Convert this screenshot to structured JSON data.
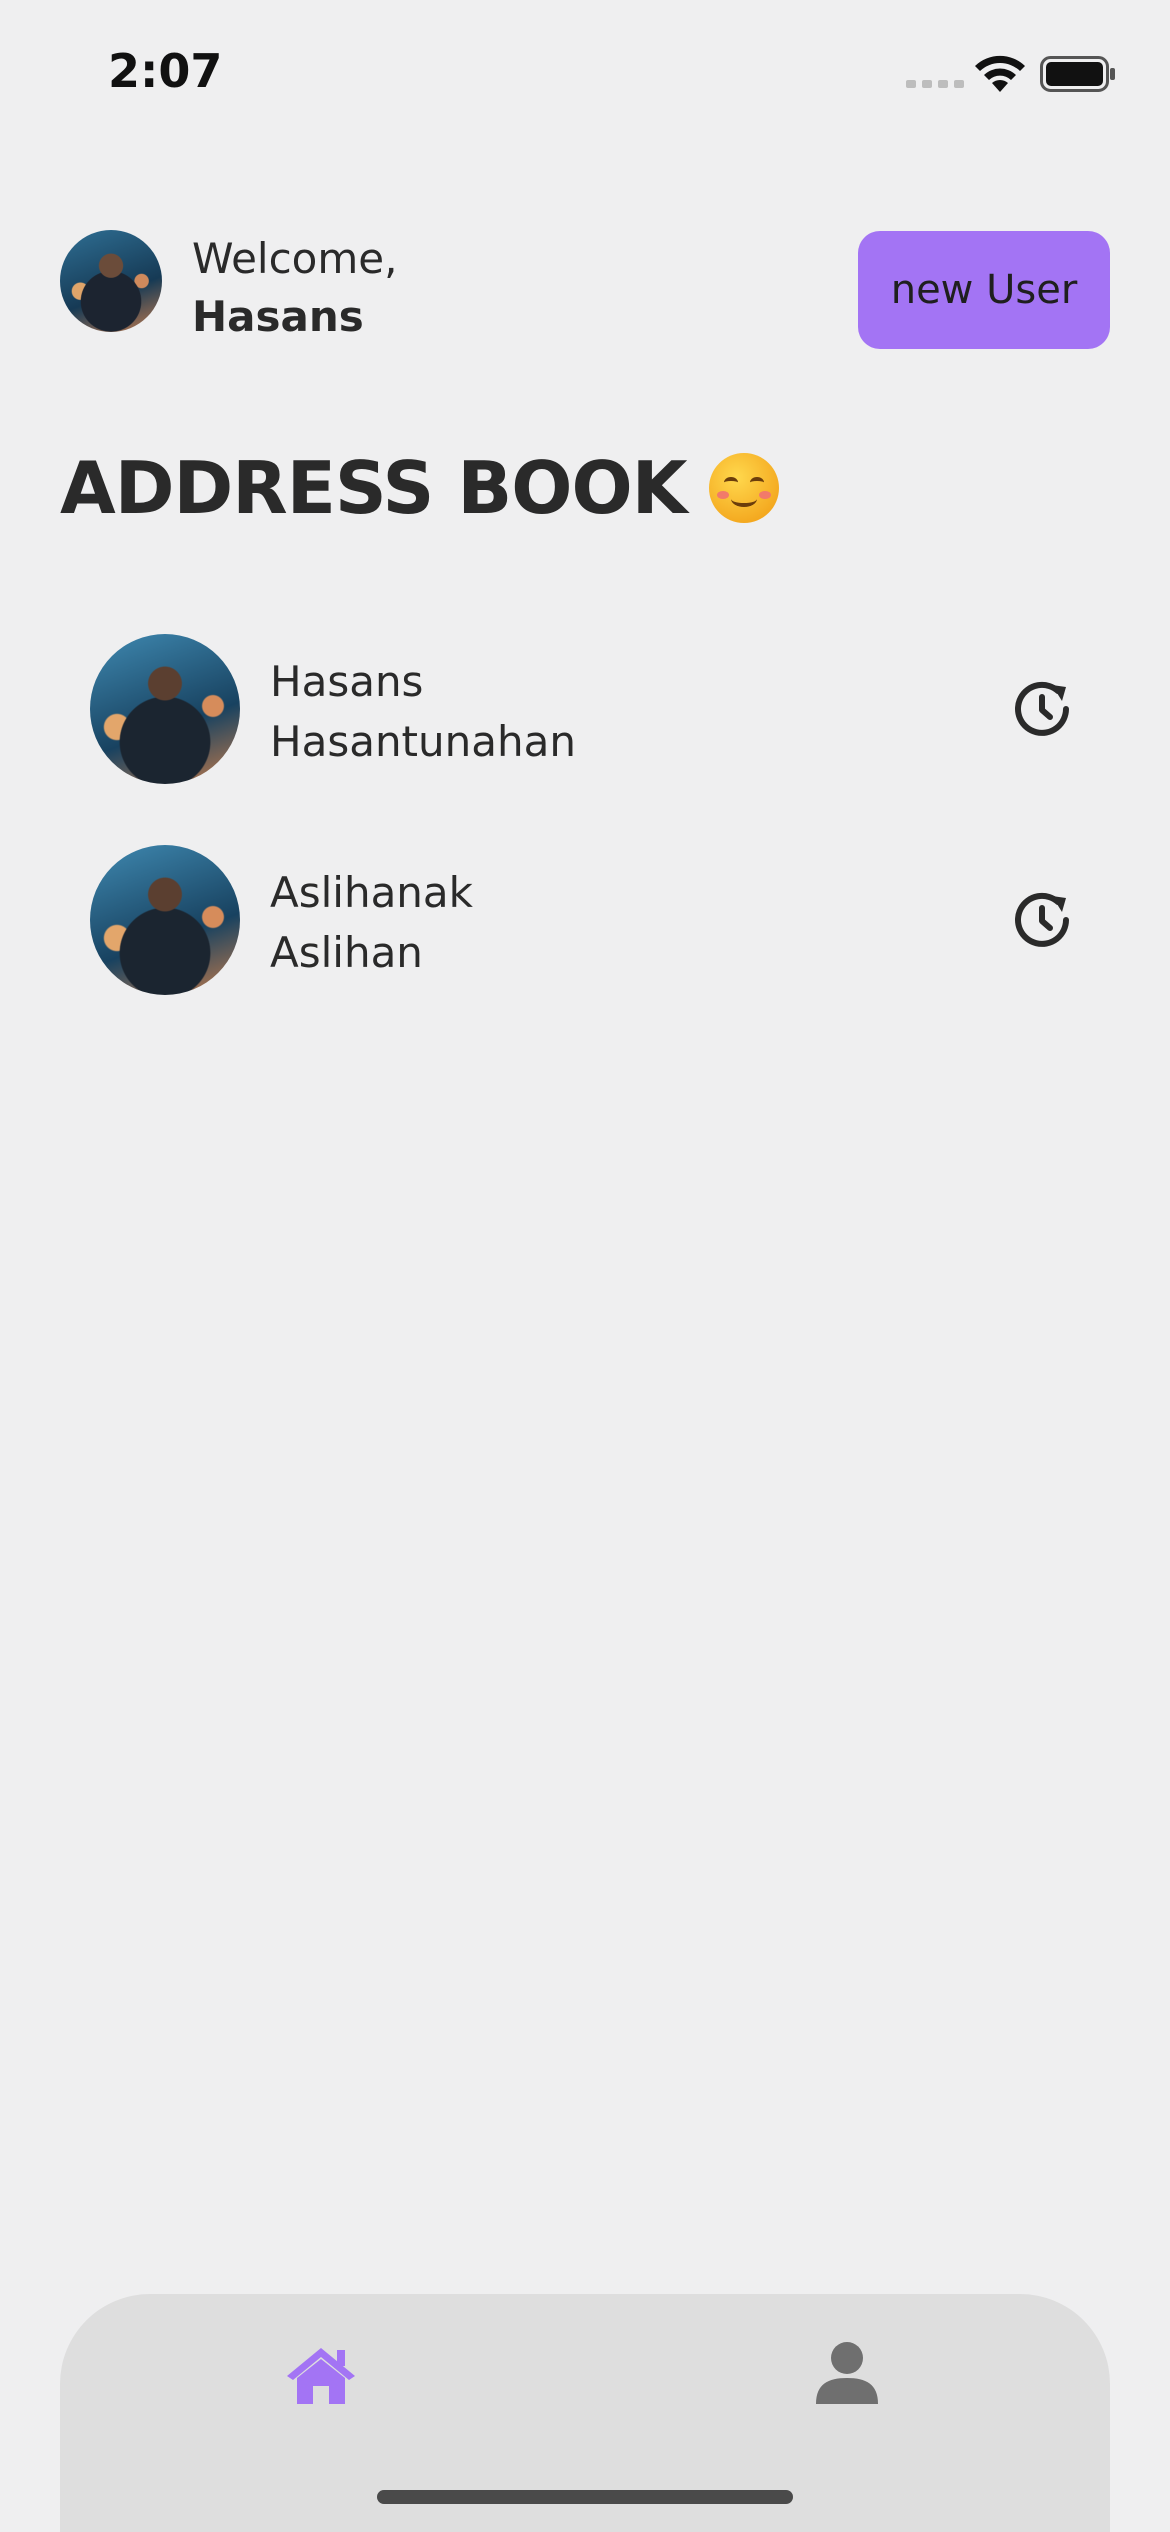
{
  "status_bar": {
    "time": "2:07"
  },
  "header": {
    "greeting": "Welcome,",
    "username": "Hasans",
    "new_user_label": "new User"
  },
  "page": {
    "title": "ADDRESS BOOK"
  },
  "contacts": [
    {
      "first_line": "Hasans",
      "second_line": "Hasantunahan"
    },
    {
      "first_line": "Aslihanak",
      "second_line": "Aslihan"
    }
  ],
  "tab_bar": {
    "items": [
      {
        "icon": "home-icon",
        "active": true
      },
      {
        "icon": "user-icon",
        "active": false
      }
    ]
  },
  "colors": {
    "accent": "#a374f4",
    "background": "#efeff0",
    "tab_bar": "#dedede",
    "inactive_icon": "#6f6f6f"
  }
}
